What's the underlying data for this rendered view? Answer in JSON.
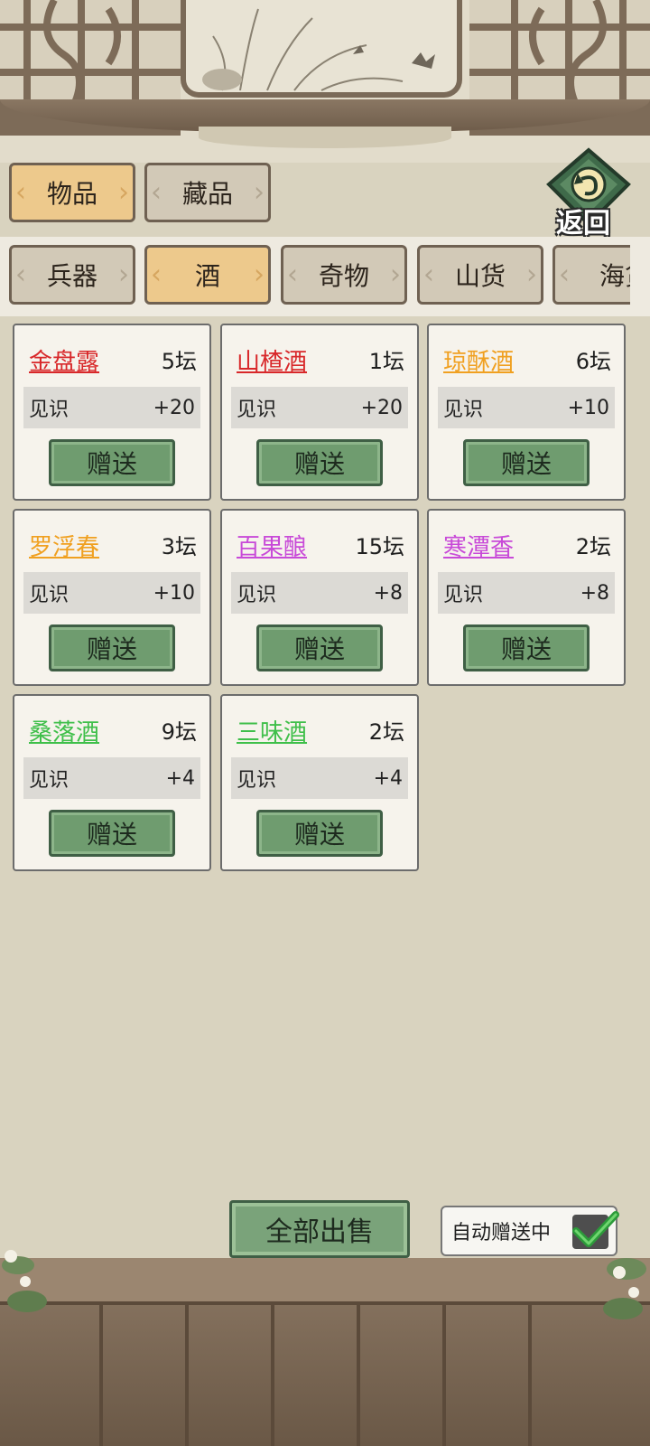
{
  "tabs": [
    {
      "label": "物品",
      "active": true
    },
    {
      "label": "藏品",
      "active": false
    }
  ],
  "back_button": {
    "label": "返回",
    "icon": "return-arrow-icon"
  },
  "categories": [
    {
      "label": "兵器",
      "active": false
    },
    {
      "label": "酒",
      "active": true
    },
    {
      "label": "奇物",
      "active": false
    },
    {
      "label": "山货",
      "active": false
    },
    {
      "label": "海货",
      "active": false
    }
  ],
  "stat_label": "见识",
  "give_label": "赠送",
  "items": [
    {
      "name": "金盘露",
      "qty": "5坛",
      "stat": "+20",
      "color": "#d8282a"
    },
    {
      "name": "山楂酒",
      "qty": "1坛",
      "stat": "+20",
      "color": "#d8282a"
    },
    {
      "name": "琼酥酒",
      "qty": "6坛",
      "stat": "+10",
      "color": "#f0a020"
    },
    {
      "name": "罗浮春",
      "qty": "3坛",
      "stat": "+10",
      "color": "#f0a020"
    },
    {
      "name": "百果酿",
      "qty": "15坛",
      "stat": "+8",
      "color": "#c84ad8"
    },
    {
      "name": "寒潭香",
      "qty": "2坛",
      "stat": "+8",
      "color": "#c84ad8"
    },
    {
      "name": "桑落酒",
      "qty": "9坛",
      "stat": "+4",
      "color": "#3fbf4a"
    },
    {
      "name": "三味酒",
      "qty": "2坛",
      "stat": "+4",
      "color": "#3fbf4a"
    }
  ],
  "sell_all_label": "全部出售",
  "auto_give": {
    "label": "自动赠送中",
    "checked": true
  }
}
